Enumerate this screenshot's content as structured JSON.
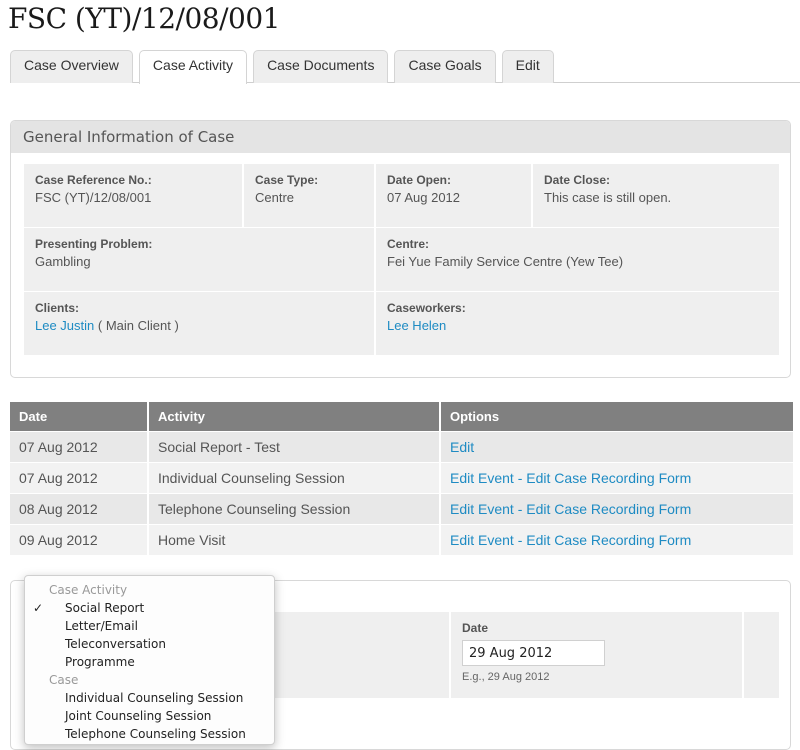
{
  "page": {
    "title": "FSC (YT)/12/08/001"
  },
  "tabs": [
    {
      "label": "Case Overview",
      "active": false
    },
    {
      "label": "Case Activity",
      "active": true
    },
    {
      "label": "Case Documents",
      "active": false
    },
    {
      "label": "Case Goals",
      "active": false
    },
    {
      "label": "Edit",
      "active": false
    }
  ],
  "general_info": {
    "heading": "General Information of Case",
    "case_ref_label": "Case Reference No.:",
    "case_ref_value": "FSC (YT)/12/08/001",
    "case_type_label": "Case Type:",
    "case_type_value": "Centre",
    "date_open_label": "Date Open:",
    "date_open_value": "07 Aug 2012",
    "date_close_label": "Date Close:",
    "date_close_value": "This case is still open.",
    "problem_label": "Presenting Problem:",
    "problem_value": "Gambling",
    "centre_label": "Centre:",
    "centre_value": "Fei Yue Family Service Centre (Yew Tee)",
    "clients_label": "Clients:",
    "client_name": "Lee Justin",
    "client_role": " ( Main Client )",
    "caseworkers_label": "Caseworkers:",
    "caseworker_name": "Lee Helen"
  },
  "activity_table": {
    "headers": [
      "Date",
      "Activity",
      "Options"
    ],
    "rows": [
      {
        "date": "07 Aug 2012",
        "activity": "Social Report - Test",
        "opt1": "Edit",
        "sep": "",
        "opt2": ""
      },
      {
        "date": "07 Aug 2012",
        "activity": "Individual Counseling Session",
        "opt1": "Edit Event",
        "sep": " - ",
        "opt2": "Edit Case Recording Form"
      },
      {
        "date": "08 Aug 2012",
        "activity": "Telephone Counseling Session",
        "opt1": "Edit Event",
        "sep": " - ",
        "opt2": "Edit Case Recording Form"
      },
      {
        "date": "09 Aug 2012",
        "activity": "Home Visit",
        "opt1": "Edit Event",
        "sep": " - ",
        "opt2": "Edit Case Recording Form"
      }
    ]
  },
  "new_activity_form": {
    "date_label": "Date",
    "date_value": "29 Aug 2012",
    "date_hint": "E.g., 29 Aug 2012"
  },
  "activity_dropdown": {
    "group1": "Case Activity",
    "items1": [
      "Social Report",
      "Letter/Email",
      "Teleconversation",
      "Programme"
    ],
    "selected": "Social Report",
    "check": "✓",
    "group2": "Case",
    "items2": [
      "Individual Counseling Session",
      "Joint Counseling Session",
      "Telephone Counseling Session"
    ]
  },
  "colors": {
    "link": "#1e8bc3",
    "table_header": "#808080"
  }
}
